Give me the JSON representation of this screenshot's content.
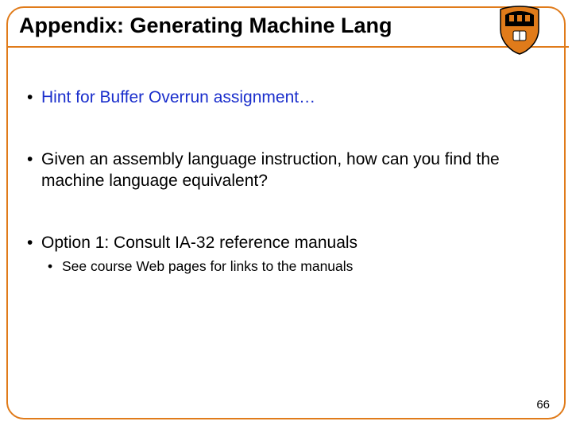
{
  "title": "Appendix: Generating Machine Lang",
  "logo_name": "princeton-shield-icon",
  "bullets": {
    "b1": "Hint for Buffer Overrun assignment…",
    "b2": "Given an assembly language instruction, how can you find the machine language equivalent?",
    "b3": "Option 1: Consult IA-32 reference manuals",
    "b3_sub1": "See course Web pages for links to the manuals"
  },
  "page_number": "66"
}
